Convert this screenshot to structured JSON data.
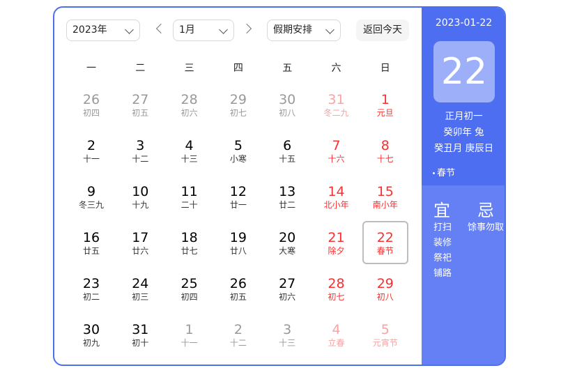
{
  "toolbar": {
    "year": "2023年",
    "month": "1月",
    "holiday": "假期安排",
    "today": "返回今天"
  },
  "weekdays": [
    "一",
    "二",
    "三",
    "四",
    "五",
    "六",
    "日"
  ],
  "weeks": [
    [
      {
        "d": "26",
        "l": "初四",
        "t": "other"
      },
      {
        "d": "27",
        "l": "初五",
        "t": "other"
      },
      {
        "d": "28",
        "l": "初六",
        "t": "other"
      },
      {
        "d": "29",
        "l": "初七",
        "t": "other"
      },
      {
        "d": "30",
        "l": "初八",
        "t": "other"
      },
      {
        "d": "31",
        "l": "冬二九",
        "t": "other wkend"
      },
      {
        "d": "1",
        "l": "元旦",
        "t": "wkend"
      }
    ],
    [
      {
        "d": "2",
        "l": "十一",
        "t": ""
      },
      {
        "d": "3",
        "l": "十二",
        "t": ""
      },
      {
        "d": "4",
        "l": "十三",
        "t": ""
      },
      {
        "d": "5",
        "l": "小寒",
        "t": ""
      },
      {
        "d": "6",
        "l": "十五",
        "t": ""
      },
      {
        "d": "7",
        "l": "十六",
        "t": "wkend"
      },
      {
        "d": "8",
        "l": "十七",
        "t": "wkend"
      }
    ],
    [
      {
        "d": "9",
        "l": "冬三九",
        "t": ""
      },
      {
        "d": "10",
        "l": "十九",
        "t": ""
      },
      {
        "d": "11",
        "l": "二十",
        "t": ""
      },
      {
        "d": "12",
        "l": "廿一",
        "t": ""
      },
      {
        "d": "13",
        "l": "廿二",
        "t": ""
      },
      {
        "d": "14",
        "l": "北小年",
        "t": "wkend"
      },
      {
        "d": "15",
        "l": "南小年",
        "t": "wkend"
      }
    ],
    [
      {
        "d": "16",
        "l": "廿五",
        "t": ""
      },
      {
        "d": "17",
        "l": "廿六",
        "t": ""
      },
      {
        "d": "18",
        "l": "廿七",
        "t": ""
      },
      {
        "d": "19",
        "l": "廿八",
        "t": ""
      },
      {
        "d": "20",
        "l": "大寒",
        "t": ""
      },
      {
        "d": "21",
        "l": "除夕",
        "t": "wkend"
      },
      {
        "d": "22",
        "l": "春节",
        "t": "wkend sel-day"
      }
    ],
    [
      {
        "d": "23",
        "l": "初二",
        "t": ""
      },
      {
        "d": "24",
        "l": "初三",
        "t": ""
      },
      {
        "d": "25",
        "l": "初四",
        "t": ""
      },
      {
        "d": "26",
        "l": "初五",
        "t": ""
      },
      {
        "d": "27",
        "l": "初六",
        "t": ""
      },
      {
        "d": "28",
        "l": "初七",
        "t": "wkend"
      },
      {
        "d": "29",
        "l": "初八",
        "t": "wkend"
      }
    ],
    [
      {
        "d": "30",
        "l": "初九",
        "t": ""
      },
      {
        "d": "31",
        "l": "初十",
        "t": ""
      },
      {
        "d": "1",
        "l": "十一",
        "t": "other"
      },
      {
        "d": "2",
        "l": "十二",
        "t": "other"
      },
      {
        "d": "3",
        "l": "十三",
        "t": "other"
      },
      {
        "d": "4",
        "l": "立春",
        "t": "other wkend"
      },
      {
        "d": "5",
        "l": "元宵节",
        "t": "other wkend"
      }
    ]
  ],
  "panel": {
    "date": "2023-01-22",
    "day": "22",
    "lunar": "正月初一",
    "ganzhi_year": "癸卯年 兔",
    "ganzhi_month_day": "癸丑月 庚辰日",
    "festival": "春节",
    "yi_title": "宜",
    "ji_title": "忌",
    "yi": [
      "打扫",
      "装修",
      "祭祀",
      "铺路"
    ],
    "ji": [
      "馀事勿取"
    ]
  },
  "colors": {
    "accent": "#4e6ef2",
    "panel_lower": "#6580f5",
    "weekend": "#f73131"
  }
}
